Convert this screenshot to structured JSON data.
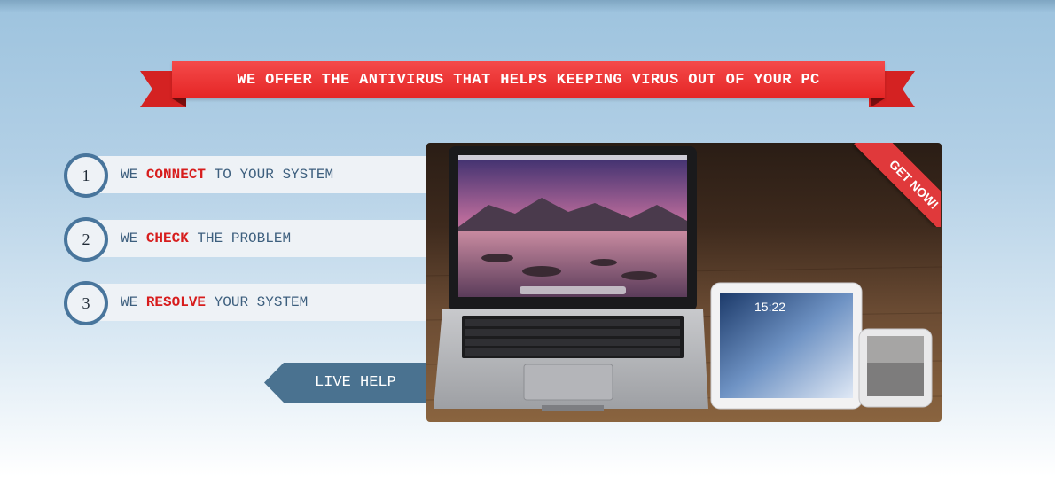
{
  "banner": {
    "text": "WE OFFER THE ANTIVIRUS THAT HELPS KEEPING VIRUS OUT OF YOUR PC"
  },
  "steps": [
    {
      "number": "1",
      "prefix": "WE ",
      "highlight": "CONNECT",
      "suffix": " TO YOUR SYSTEM"
    },
    {
      "number": "2",
      "prefix": "WE ",
      "highlight": "CHECK",
      "suffix": " THE PROBLEM"
    },
    {
      "number": "3",
      "prefix": "WE ",
      "highlight": "RESOLVE",
      "suffix": " YOUR SYSTEM"
    }
  ],
  "live_help": {
    "label": "LIVE HELP"
  },
  "product_photo": {
    "badge": "GET NOW!",
    "tablet_clock": "15:22"
  },
  "colors": {
    "accent_red": "#e52525",
    "steel_blue": "#48759c"
  }
}
